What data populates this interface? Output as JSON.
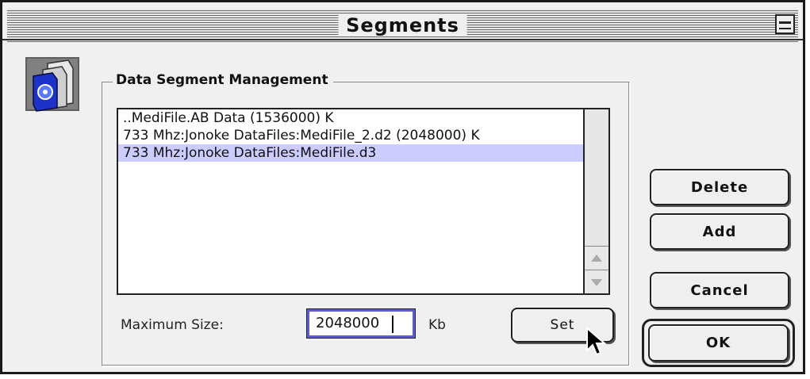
{
  "window": {
    "title": "Segments"
  },
  "group": {
    "title": "Data Segment Management"
  },
  "segments_list": {
    "items": [
      {
        "text": "..MediFile.AB Data (1536000) K",
        "selected": false
      },
      {
        "text": "733 Mhz:Jonoke DataFiles:MediFile_2.d2 (2048000) K",
        "selected": false
      },
      {
        "text": "733 Mhz:Jonoke DataFiles:MediFile.d3",
        "selected": true
      }
    ]
  },
  "max_size": {
    "label": "Maximum Size:",
    "value": "2048000",
    "unit": "Kb",
    "set_label": "Set"
  },
  "buttons": {
    "delete": "Delete",
    "add": "Add",
    "cancel": "Cancel",
    "ok": "OK"
  },
  "colors": {
    "selection": "#ccccff",
    "input_focus": "#5b5bd6",
    "window_bg": "#f0f0f0"
  },
  "icons": {
    "app": "data-disk-icon",
    "zoom": "window-zoom-icon",
    "cursor": "arrow-cursor-icon"
  }
}
